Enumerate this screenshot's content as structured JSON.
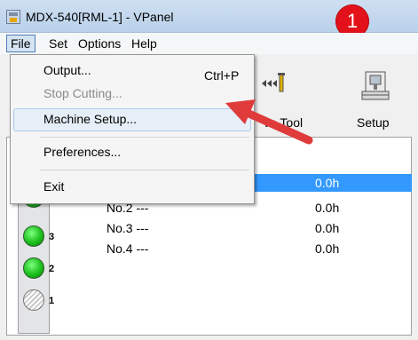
{
  "window": {
    "title": "MDX-540[RML-1] - VPanel",
    "app_icon": "vpanel-app-icon"
  },
  "annotation": {
    "step_number": "1",
    "color": "#e3121a"
  },
  "menubar": {
    "items": [
      "File",
      "Set",
      "Options",
      "Help"
    ]
  },
  "file_menu": {
    "items": [
      {
        "label": "Output...",
        "shortcut": "Ctrl+P",
        "enabled": true
      },
      {
        "label": "Stop Cutting...",
        "enabled": false
      },
      {
        "label": "Machine Setup...",
        "enabled": true,
        "highlighted": true
      },
      {
        "label": "Preferences...",
        "enabled": true
      },
      {
        "label": "Exit",
        "enabled": true
      }
    ]
  },
  "toolbar": {
    "move_tool_label": "ve Tool",
    "setup_label": "Setup"
  },
  "tools": {
    "rows": [
      {
        "name": "",
        "time": "0.0h",
        "selected": true
      },
      {
        "name": "No.2 ---",
        "time": "0.0h"
      },
      {
        "name": "No.3 ---",
        "time": "0.0h"
      },
      {
        "name": "No.4 ---",
        "time": "0.0h"
      }
    ]
  },
  "indicators": [
    {
      "label": "",
      "state": "on"
    },
    {
      "label": "3",
      "state": "on"
    },
    {
      "label": "2",
      "state": "on"
    },
    {
      "label": "1",
      "state": "off"
    }
  ]
}
